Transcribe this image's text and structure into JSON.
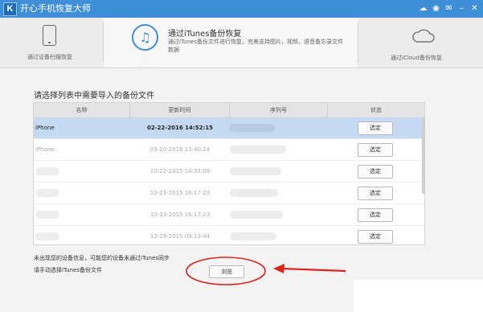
{
  "app": {
    "logo_letter": "K",
    "title": "开心手机恢复大师",
    "tray_icons": [
      "chat-icon",
      "weibo-icon",
      "message-icon",
      "minimize-icon",
      "close-icon"
    ]
  },
  "modes": {
    "device": {
      "caption": "通过设备扫描恢复",
      "icon": "phone-icon"
    },
    "itunes": {
      "title": "通过iTunes备份恢复",
      "description": "通过iTunes备份文件进行恢复，完美支持图片，视频，语音备忘录文件数据",
      "icon": "music-note-icon"
    },
    "icloud": {
      "caption": "通过iCloud备份恢复",
      "icon": "cloud-icon"
    }
  },
  "list": {
    "prompt": "请选择列表中需要导入的备份文件",
    "headers": {
      "name": "名称",
      "time": "更新时间",
      "serial": "序列号",
      "status": "状态"
    },
    "rows": [
      {
        "name": "iPhone",
        "time": "02-22-2016 14:52:15",
        "button": "选定",
        "selected": true
      },
      {
        "name": "iPhone",
        "time": "03-10-2016 13:40:24",
        "button": "选定",
        "selected": false
      },
      {
        "name": "",
        "time": "10-22-2015 14:33:09",
        "button": "选定",
        "selected": false
      },
      {
        "name": "",
        "time": "10-23-2015 16:17:23",
        "button": "选定",
        "selected": false
      },
      {
        "name": "",
        "time": "10-23-2015 16:17:23",
        "button": "选定",
        "selected": false
      },
      {
        "name": "",
        "time": "12-29-2015 09:13:44",
        "button": "选定",
        "selected": false
      }
    ]
  },
  "footer": {
    "note_line1": "未出现您的设备信息，可能您的设备未通过iTunes同步",
    "note_line2": "请手动选择iTunes备份文件",
    "browse_label": "浏览"
  },
  "colors": {
    "titlebar": "#3f8ed8",
    "selected_row": "#c5daf2",
    "annotation_red": "#e0221b"
  }
}
